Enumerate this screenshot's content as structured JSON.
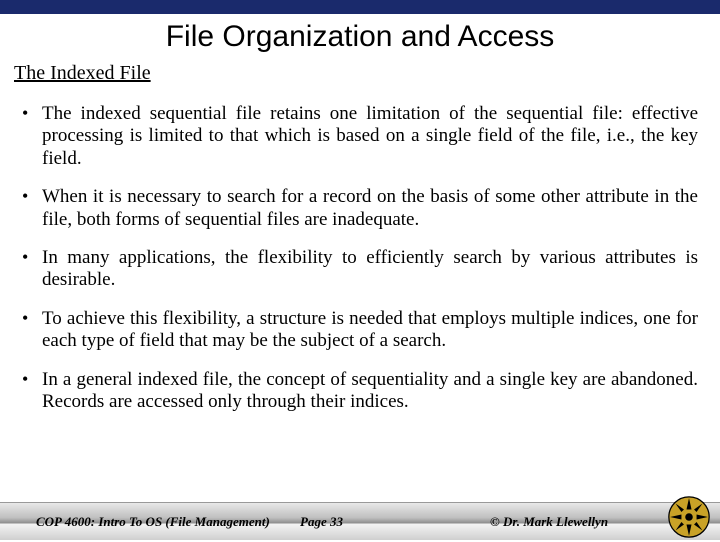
{
  "title": "File Organization and Access",
  "subtitle": "The Indexed File",
  "bullets": {
    "b0": "The indexed sequential file retains one limitation of the sequential file: effective processing is limited to that which is based on a single field of the file, i.e., the key field.",
    "b1": "When it is necessary to search for a record on the basis of some other attribute in the file, both forms of sequential files are inadequate.",
    "b2": "In many applications, the flexibility to efficiently search by various attributes is desirable.",
    "b3": "To achieve this flexibility, a structure is needed that employs multiple indices, one for each type of field that may be the subject of a search.",
    "b4": "In a general indexed file, the concept of sequentiality and a single key are abandoned.  Records are accessed only through their indices."
  },
  "footer": {
    "course": "COP 4600: Intro To OS  (File Management)",
    "page": "Page 33",
    "author": "© Dr. Mark Llewellyn"
  }
}
